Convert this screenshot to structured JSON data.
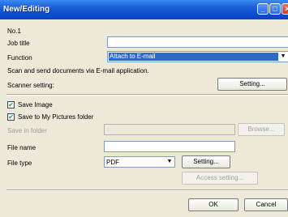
{
  "window": {
    "title": "New/Editing"
  },
  "form": {
    "number_label": "No.1",
    "job_title_label": "Job title",
    "job_title_value": "",
    "function_label": "Function",
    "function_value": "Attach to E-mail",
    "description": "Scan and send documents via E-mail application.",
    "scanner_setting_label": "Scanner setting:",
    "scanner_setting_button": "Setting...",
    "save_image_label": "Save Image",
    "save_image_checked": true,
    "save_to_pictures_label": "Save to My Pictures folder",
    "save_to_pictures_checked": true,
    "save_in_folder_label": "Save in folder",
    "save_in_folder_value": "",
    "browse_button": "Browse...",
    "file_name_label": "File name",
    "file_name_value": "",
    "file_type_label": "File type",
    "file_type_value": "PDF",
    "file_type_setting_button": "Setting...",
    "access_setting_button": "Access setting...",
    "ok_button": "OK",
    "cancel_button": "Cancel"
  },
  "icons": {
    "check": "✔",
    "dropdown": "▼",
    "minimize": "_",
    "maximize": "□",
    "close": "✕"
  }
}
